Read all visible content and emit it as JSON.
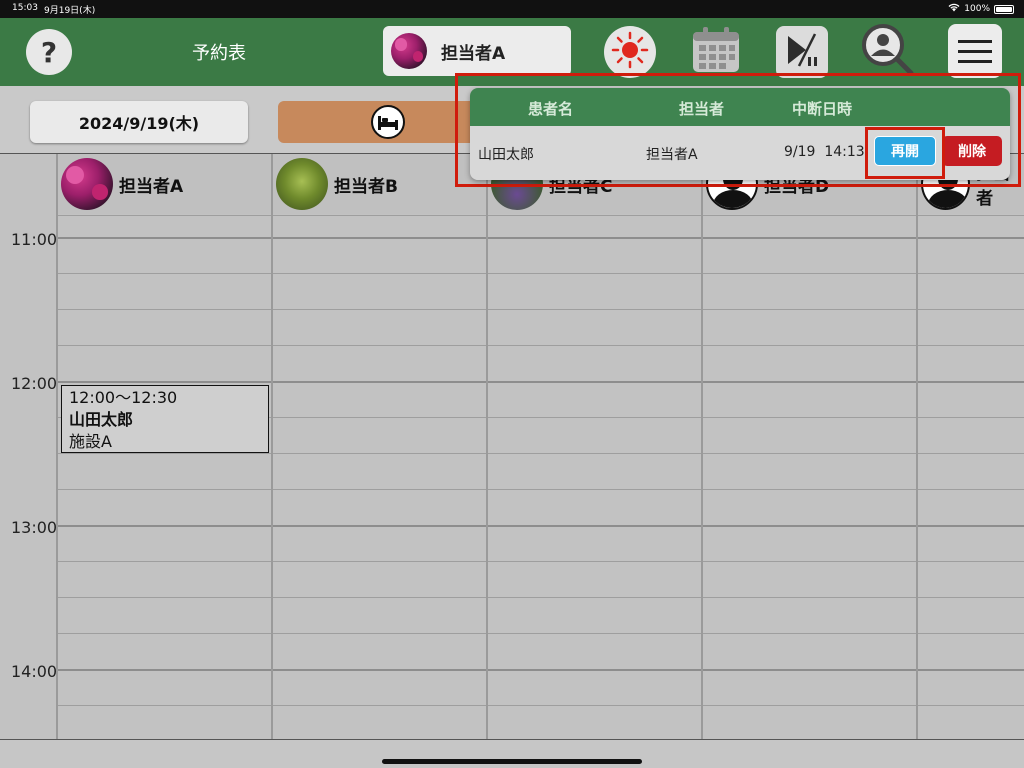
{
  "status_bar": {
    "time": "15:03",
    "date": "9月19日(木)",
    "battery": "100%"
  },
  "header": {
    "title": "予約表",
    "help_label": "?",
    "selected_staff": "担当者A",
    "icons": [
      "sun-icon",
      "calendar-icon",
      "pause-list-icon",
      "user-search-icon",
      "menu-icon"
    ]
  },
  "toolbar": {
    "date": "2024/9/19(木)",
    "bed_icon": "bed-icon"
  },
  "grid": {
    "columns": [
      {
        "label": "担当者A",
        "avatar": "flower"
      },
      {
        "label": "担当者B",
        "avatar": "leaf"
      },
      {
        "label": "担当者C",
        "avatar": "purple"
      },
      {
        "label": "担当者D",
        "avatar": "person"
      },
      {
        "label": "担当者",
        "avatar": "person"
      }
    ],
    "times": [
      "11:00",
      "12:00",
      "13:00",
      "14:00"
    ]
  },
  "appointment": {
    "time": "12:00～12:30",
    "patient": "山田太郎",
    "facility": "施設A"
  },
  "popup": {
    "headers": {
      "patient": "患者名",
      "staff": "担当者",
      "paused_at": "中断日時"
    },
    "row": {
      "patient": "山田太郎",
      "staff": "担当者A",
      "paused_at": "9/19  14:13"
    },
    "resume_label": "再開",
    "delete_label": "削除"
  },
  "colors": {
    "header_green": "#3b7a45",
    "popup_green": "#3f8450",
    "resume_blue": "#2aa6e0",
    "delete_red": "#c51c22",
    "highlight_red": "#d01c0c"
  }
}
